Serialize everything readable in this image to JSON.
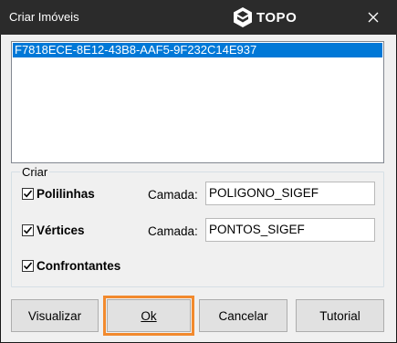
{
  "window": {
    "title": "Criar Imóveis",
    "logo_text": "TOPO",
    "close_icon": "close-icon"
  },
  "list": {
    "items": [
      "F7818ECE-8E12-43B8-AAF5-9F232C14E937"
    ]
  },
  "group": {
    "label": "Criar",
    "polilinhas": {
      "label": "Polilinhas",
      "checked": true
    },
    "vertices": {
      "label": "Vértices",
      "checked": true
    },
    "confrontantes": {
      "label": "Confrontantes",
      "checked": true
    },
    "camada_label_1": "Camada:",
    "camada_value_1": "POLIGONO_SIGEF",
    "camada_label_2": "Camada:",
    "camada_value_2": "PONTOS_SIGEF"
  },
  "buttons": {
    "visualizar": "Visualizar",
    "ok": "Ok",
    "cancelar": "Cancelar",
    "tutorial": "Tutorial"
  },
  "colors": {
    "selection": "#0078d7",
    "titlebar": "#2b2b2b",
    "highlight_outline": "#f28a2e"
  }
}
